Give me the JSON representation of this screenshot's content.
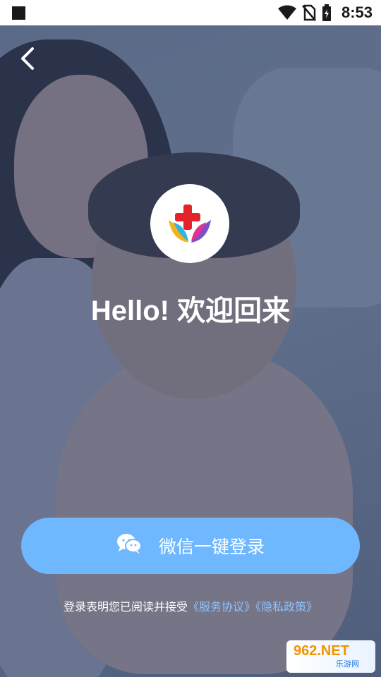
{
  "status_bar": {
    "time": "8:53"
  },
  "welcome": {
    "title": "Hello! 欢迎回来"
  },
  "wechat_login": {
    "label": "微信一键登录"
  },
  "agreement": {
    "prefix": "登录表明您已阅读并接受",
    "service_link": "《服务协议》",
    "privacy_link": "《隐私政策》"
  },
  "watermark": {
    "brand": "962.NET",
    "sub": "乐游网"
  },
  "colors": {
    "accent": "#6fb8ff",
    "link": "#8cc4ff",
    "text": "#ffffff"
  },
  "icons": [
    "back-icon",
    "wechat-icon",
    "app-logo-icon",
    "wifi-icon",
    "no-sim-icon",
    "battery-icon"
  ]
}
